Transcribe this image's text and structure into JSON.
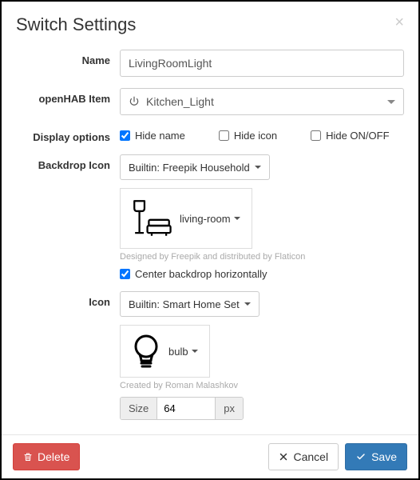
{
  "dialog": {
    "title": "Switch Settings"
  },
  "labels": {
    "name": "Name",
    "openhab_item": "openHAB Item",
    "display_options": "Display options",
    "backdrop_icon": "Backdrop Icon",
    "icon": "Icon"
  },
  "fields": {
    "name_value": "LivingRoomLight",
    "item_select_value": "Kitchen_Light",
    "backdrop_iconset": "Builtin: Freepik Household",
    "backdrop_preview_label": "living-room",
    "backdrop_credit": "Designed by Freepik and distributed by Flaticon",
    "center_backdrop_label": "Center backdrop horizontally",
    "icon_iconset": "Builtin: Smart Home Set",
    "icon_preview_label": "bulb",
    "icon_credit": "Created by Roman Malashkov",
    "size_addon": "Size",
    "size_value": "64",
    "size_unit": "px"
  },
  "checkboxes": {
    "hide_name": "Hide name",
    "hide_icon": "Hide icon",
    "hide_onoff": "Hide ON/OFF"
  },
  "footer": {
    "delete": "Delete",
    "cancel": "Cancel",
    "save": "Save"
  }
}
